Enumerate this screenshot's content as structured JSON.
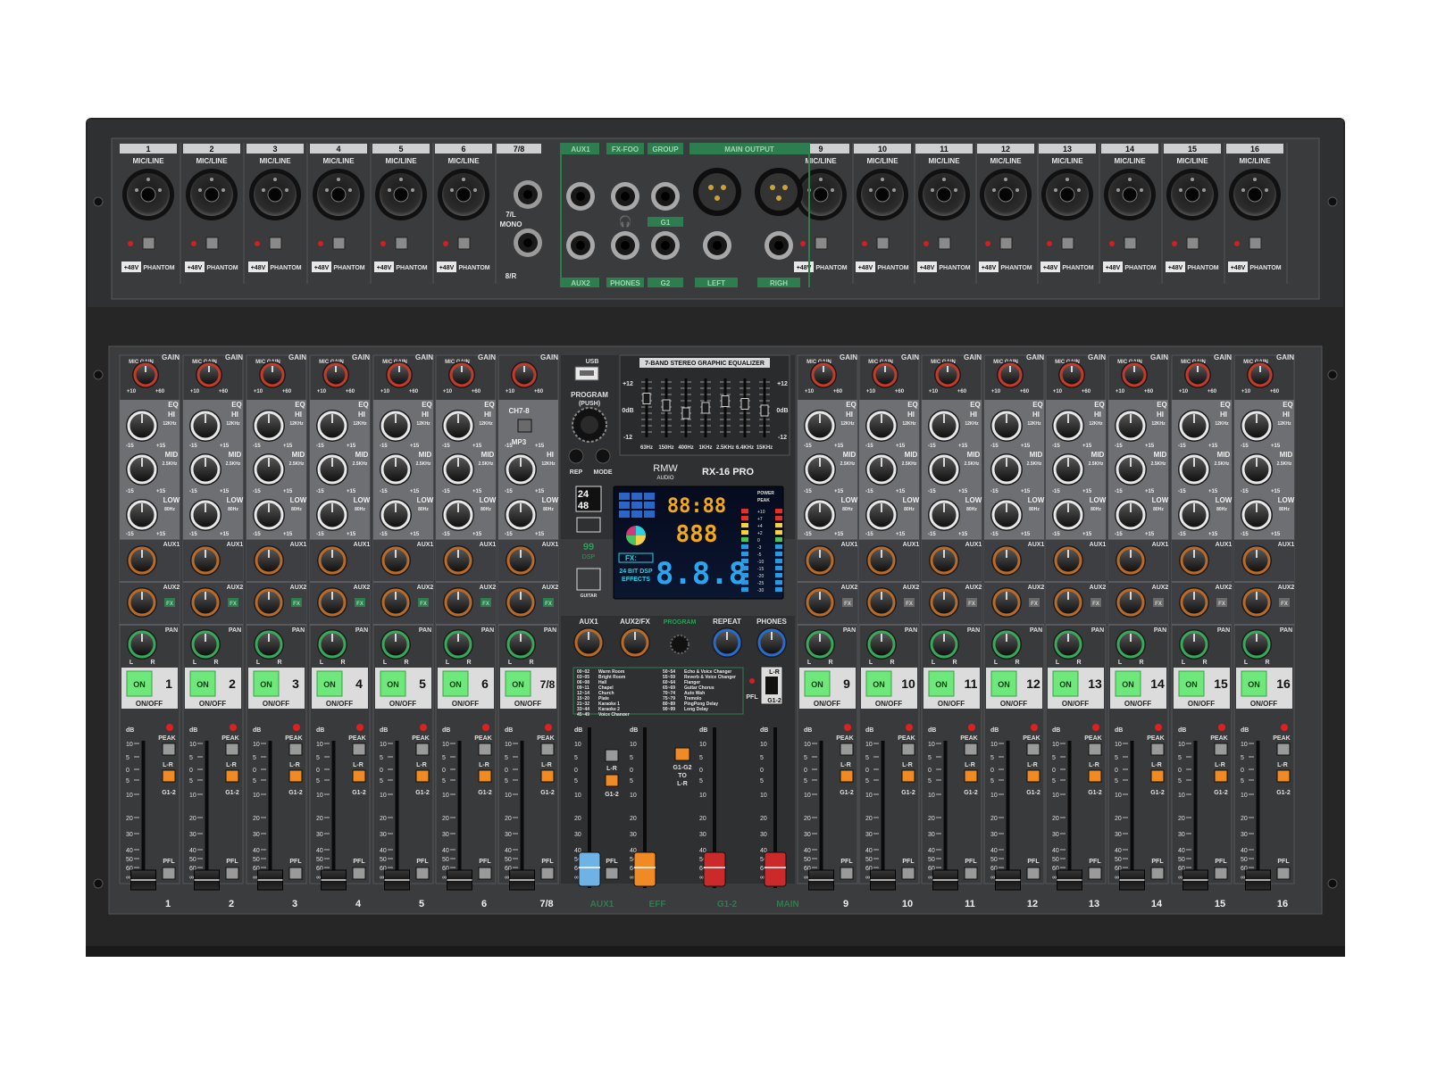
{
  "brand": {
    "name": "RMW",
    "sub": "AUDIO",
    "model": "RX-16 PRO"
  },
  "rear": {
    "mic_line": "MIC/LINE",
    "phantom_48v": "+48V",
    "phantom": "PHANTOM",
    "mono_left": "7/L",
    "mono": "MONO",
    "mono_right": "8/R",
    "groups": {
      "aux1": "AUX1",
      "fx_foo": "FX-FOO",
      "group": "GROUP",
      "main_output": "MAIN OUTPUT",
      "g1": "G1",
      "aux2": "AUX2",
      "phones": "PHONES",
      "g2": "G2",
      "left": "LEFT",
      "right": "RIGH"
    }
  },
  "channels": [
    {
      "label": "1"
    },
    {
      "label": "2"
    },
    {
      "label": "3"
    },
    {
      "label": "4"
    },
    {
      "label": "5"
    },
    {
      "label": "6"
    },
    {
      "label": "7/8"
    },
    {
      "label": "9"
    },
    {
      "label": "10"
    },
    {
      "label": "11"
    },
    {
      "label": "12"
    },
    {
      "label": "13"
    },
    {
      "label": "14"
    },
    {
      "label": "15"
    },
    {
      "label": "16"
    }
  ],
  "strip": {
    "gain": "GAIN",
    "mic_gain": "MIC GAIN",
    "gain_min": "+10",
    "gain_max": "+60",
    "eq": "EQ",
    "hi": "HI",
    "hi_freq": "12KHz",
    "mid": "MID",
    "mid_freq": "2.5KHz",
    "low": "LOW",
    "low_freq": "80Hz",
    "eq_min": "-15",
    "eq_max": "+15",
    "aux1": "AUX1",
    "aux2": "AUX2",
    "fx": "FX",
    "pan": "PAN",
    "pan_l": "L",
    "pan_r": "R",
    "on": "ON",
    "on_off": "ON/OFF",
    "peak": "PEAK",
    "lr": "L-R",
    "g12": "G1-2",
    "pfl": "PFL",
    "db": "dB",
    "ch78_btn": "CH7-8",
    "mp3_btn": "MP3"
  },
  "fader_scale": [
    "10",
    "5",
    "0",
    "5",
    "10",
    "20",
    "30",
    "40",
    "50",
    "60",
    "∞"
  ],
  "master": {
    "usb": "USB",
    "program": "PROGRAM",
    "push": "(PUSH)",
    "rep": "REP",
    "mode": "MODE",
    "bit_24": "24",
    "khz_48": "48",
    "dsp_99": "99",
    "dsp": "DSP",
    "guitar": "GUITAR",
    "eq_title": "7-BAND STEREO GRAPHIC EQUALIZER",
    "eq_plus": "+12",
    "eq_zero": "0dB",
    "eq_minus": "-12",
    "eq_bands": [
      "63Hz",
      "150Hz",
      "400Hz",
      "1KHz",
      "2.5KHz",
      "6.4KHz",
      "15KHz"
    ],
    "eq_band_levels": [
      0.35,
      0.1,
      -0.2,
      0.0,
      0.25,
      0.15,
      -0.1
    ],
    "knob_aux1": "AUX1",
    "knob_aux2fx": "AUX2/FX",
    "knob_program": "PROGRAM",
    "knob_repeat": "REPEAT",
    "knob_phones": "PHONES",
    "lr_switch": "L-R",
    "g12_switch": "G1-2",
    "pfl": "PFL",
    "g1g2": "G1-G2",
    "to": "TO",
    "lr": "L-R",
    "fader_aux1": "AUX1",
    "fader_eff": "EFF",
    "fader_g12": "G1-2",
    "fader_main": "MAIN"
  },
  "display": {
    "time": "88:88",
    "prog": "888",
    "big": "8.8.8",
    "fx": "FX:",
    "bit_dsp": "24 BIT DSP",
    "effects": "EFFECTS",
    "power": "POWER",
    "peak": "PEAK",
    "meter_scale": [
      "+10",
      "+7",
      "+4",
      "+2",
      "0",
      "-3",
      "-5",
      "-10",
      "-15",
      "-20",
      "-25",
      "-30"
    ]
  },
  "presets": [
    {
      "range": "00~02",
      "name": "Warm Room"
    },
    {
      "range": "03~05",
      "name": "Bright Room"
    },
    {
      "range": "06~08",
      "name": "Hall"
    },
    {
      "range": "09~11",
      "name": "Chapel"
    },
    {
      "range": "12~14",
      "name": "Church"
    },
    {
      "range": "15~20",
      "name": "Plate"
    },
    {
      "range": "21~32",
      "name": "Karaoke 1"
    },
    {
      "range": "33~44",
      "name": "Karaoke 2"
    },
    {
      "range": "45~49",
      "name": "Voice Changer"
    },
    {
      "range": "50~54",
      "name": "Echo & Voice Changer"
    },
    {
      "range": "55~59",
      "name": "Reverb & Voice Changer"
    },
    {
      "range": "60~64",
      "name": "Flanger"
    },
    {
      "range": "65~69",
      "name": "Guitar Chorus"
    },
    {
      "range": "70~74",
      "name": "Auto Wah"
    },
    {
      "range": "75~79",
      "name": "Tremolo"
    },
    {
      "range": "80~89",
      "name": "PingPong Delay"
    },
    {
      "range": "90~99",
      "name": "Long Delay"
    }
  ],
  "colors": {
    "chassis": "#2b2b2b",
    "panel": "#3d3e40",
    "green_accent": "#2e7d4f",
    "on_button": "#6ee87a",
    "orange_button": "#f08a24",
    "fader_blue": "#6fb2e6",
    "fader_orange": "#f08a24",
    "fader_red": "#cc2a2a"
  }
}
